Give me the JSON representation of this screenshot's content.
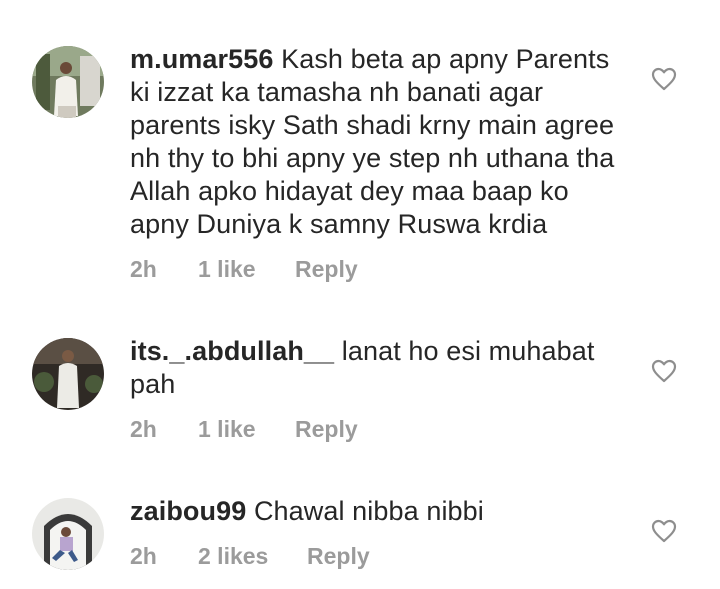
{
  "comments": [
    {
      "username": "m.umar556",
      "lines": [
        "Kash beta ap apny Parents",
        "ki izzat ka tamasha nh banati agar",
        "parents isky Sath shadi krny main agree",
        "nh thy to bhi apny ye step nh uthana tha",
        "Allah apko hidayat dey maa baap ko",
        "apny Duniya k samny Ruswa krdia"
      ],
      "time": "2h",
      "likes": "1 like",
      "reply": "Reply"
    },
    {
      "username": "its._.abdullah__",
      "lines": [
        "lanat ho esi muhabat",
        "pah"
      ],
      "time": "2h",
      "likes": "1 like",
      "reply": "Reply"
    },
    {
      "username": "zaibou99",
      "lines": [
        "Chawal nibba nibbi"
      ],
      "time": "2h",
      "likes": "2 likes",
      "reply": "Reply"
    }
  ],
  "icons": {
    "like": "heart-outline-icon"
  },
  "colors": {
    "text": "#262626",
    "meta": "#9b9b9b",
    "background": "#ffffff"
  }
}
